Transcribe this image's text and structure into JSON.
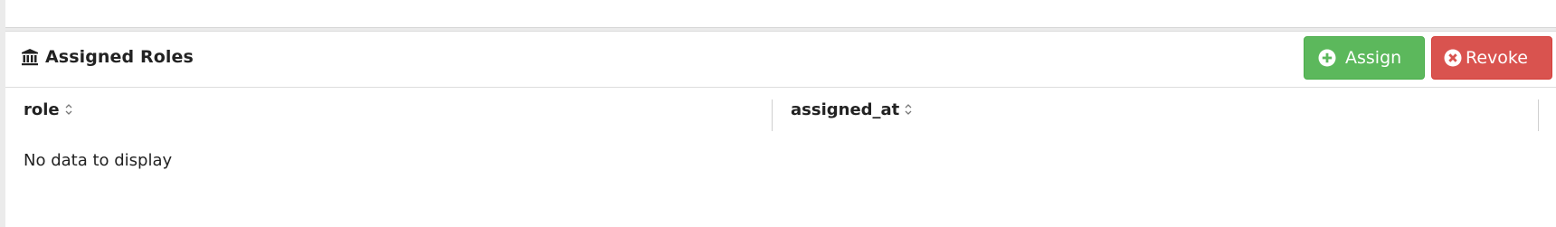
{
  "panel": {
    "title": "Assigned Roles",
    "title_icon": "bank-icon"
  },
  "toolbar": {
    "assign_label": "Assign",
    "assign_icon": "plus-circle-icon",
    "revoke_label": "Revoke",
    "revoke_icon": "x-circle-icon"
  },
  "table": {
    "columns": [
      {
        "label": "role",
        "sort_icon": "sort-icon"
      },
      {
        "label": "assigned_at",
        "sort_icon": "sort-icon"
      }
    ],
    "empty_message": "No data to display"
  },
  "colors": {
    "assign": "#5cb85c",
    "revoke": "#d9534f",
    "text": "#222222"
  }
}
